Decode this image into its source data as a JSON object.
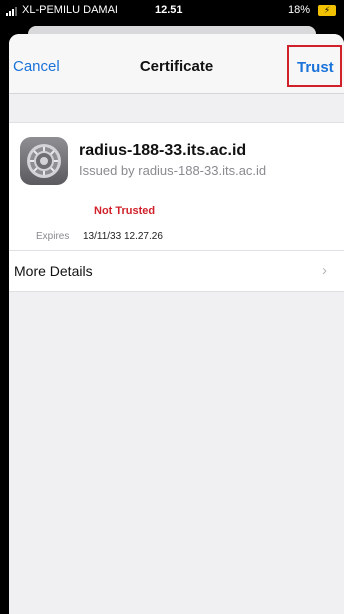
{
  "status_bar": {
    "carrier": "XL-PEMILU DAMAI",
    "time": "12.51",
    "battery_percent": "18%",
    "battery_color": "#f2c200"
  },
  "nav": {
    "cancel_label": "Cancel",
    "title": "Certificate",
    "trust_label": "Trust",
    "accent_color": "#1a73d9",
    "highlight_color": "#d0212a"
  },
  "certificate": {
    "icon": "settings-gear-icon",
    "name": "radius-188-33.its.ac.id",
    "issuer": "Issued by radius-188-33.its.ac.id",
    "trust_status": "Not Trusted",
    "expires_label": "Expires",
    "expires_value": "13/11/33 12.27.26"
  },
  "more_details": {
    "label": "More Details",
    "chevron_icon": "chevron-right-icon"
  }
}
